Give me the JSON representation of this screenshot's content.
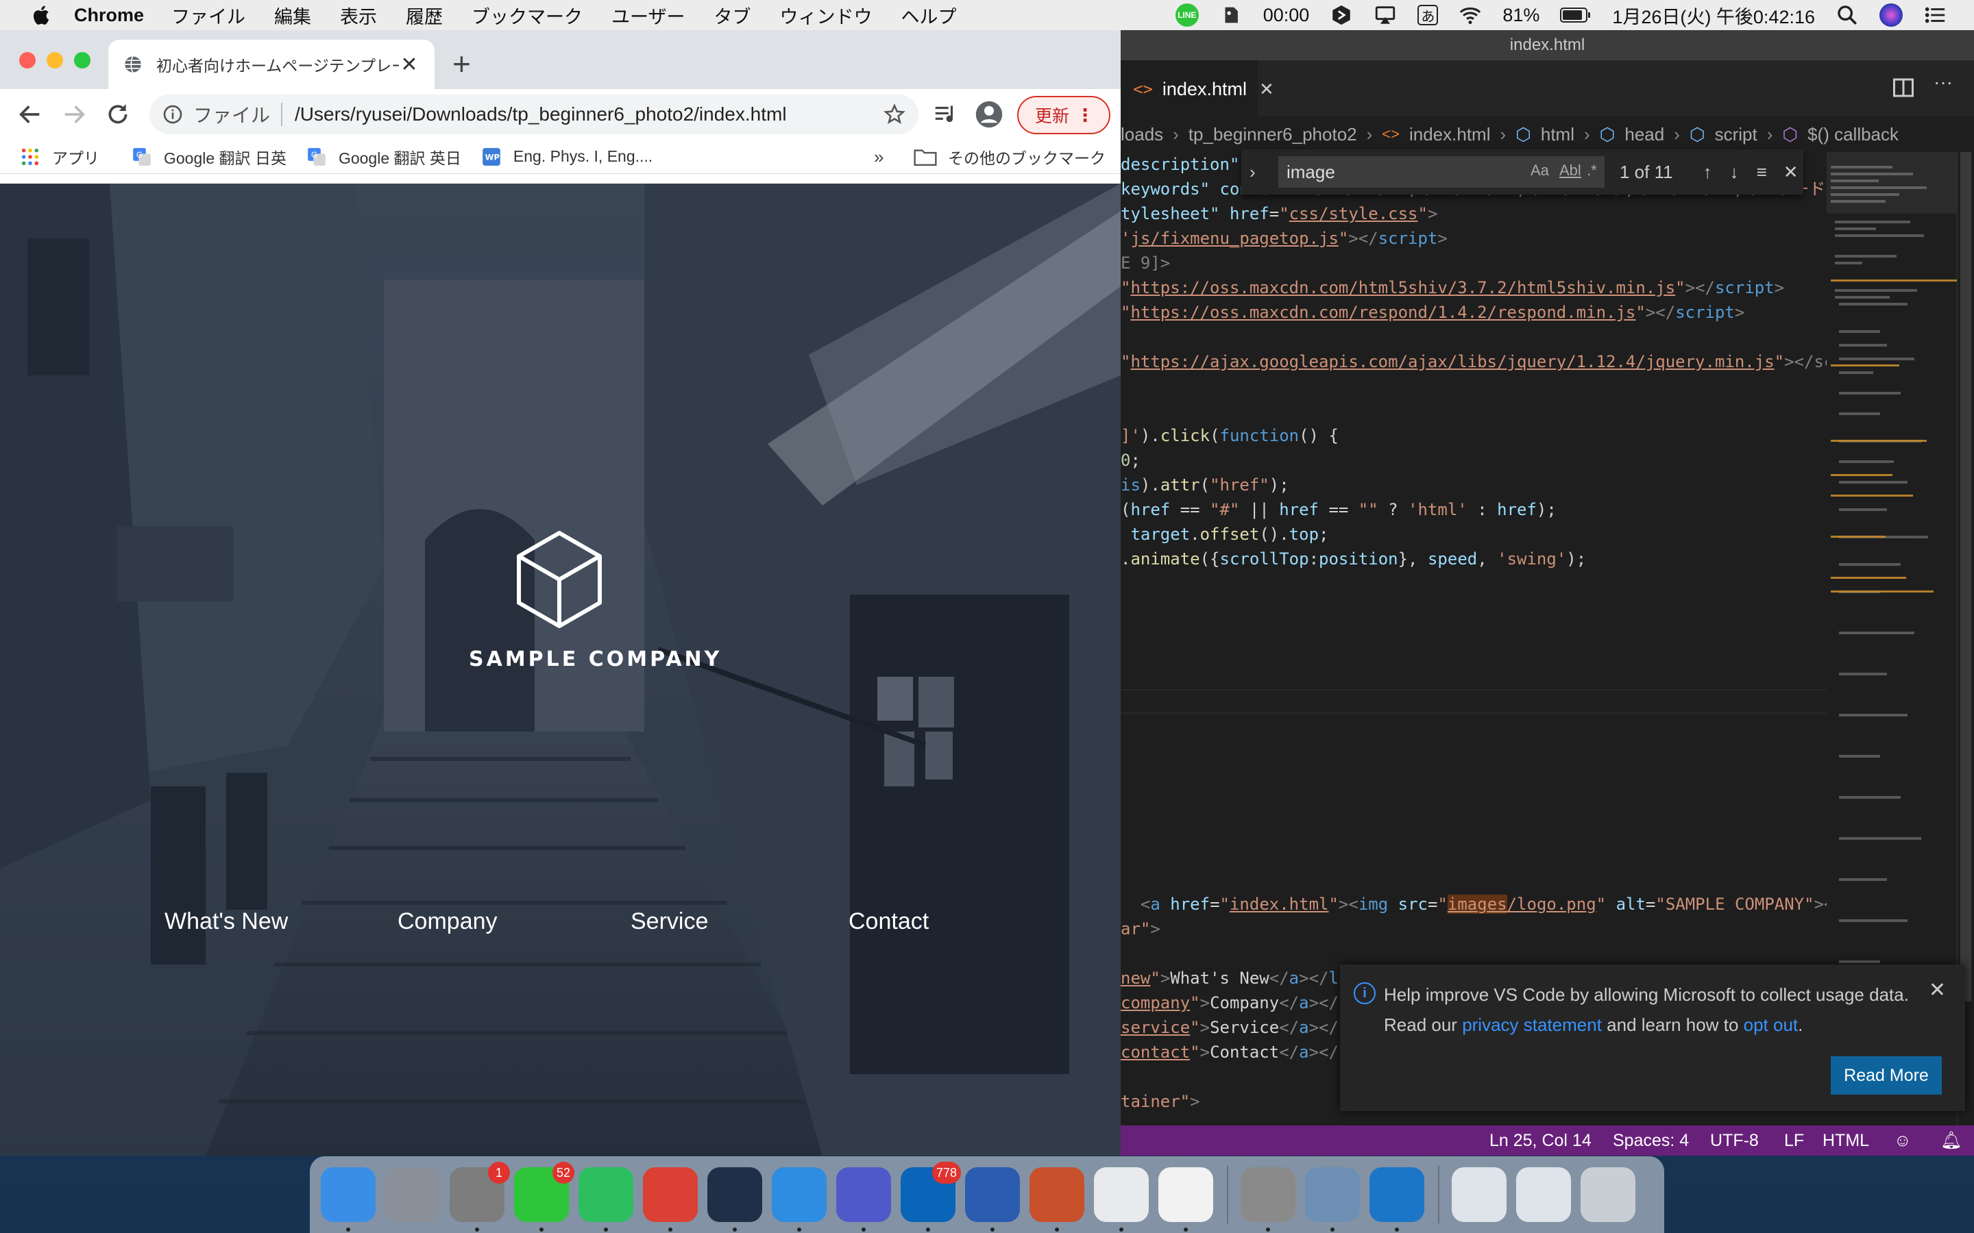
{
  "menubar": {
    "app_name": "Chrome",
    "menus": [
      "ファイル",
      "編集",
      "表示",
      "履歴",
      "ブックマーク",
      "ユーザー",
      "タブ",
      "ウィンドウ",
      "ヘルプ"
    ],
    "clock_status": "00:00",
    "input_method": "あ",
    "battery": "81%",
    "datetime": "1月26日(火) 午後0:42:16"
  },
  "chrome": {
    "tab_title": "初心者向けホームページテンプレー",
    "omnibox": {
      "scheme_label": "ファイル",
      "url": "/Users/ryusei/Downloads/tp_beginner6_photo2/index.html"
    },
    "update_label": "更新",
    "bookmarks": [
      {
        "label": "アプリ",
        "icon": "apps-grid-icon"
      },
      {
        "label": "Google 翻訳 日英",
        "icon": "google-translate-icon"
      },
      {
        "label": "Google 翻訳 英日",
        "icon": "google-translate-icon"
      },
      {
        "label": "Eng. Phys. I, Eng....",
        "icon": "wordpress-icon"
      }
    ],
    "bookmarks_more": "»",
    "other_bookmarks": "その他のブックマーク"
  },
  "page": {
    "company": "SAMPLE COMPANY",
    "nav": [
      "What's New",
      "Company",
      "Service",
      "Contact"
    ]
  },
  "vscode": {
    "window_title": "index.html",
    "tab_label": "index.html",
    "breadcrumbs": [
      "loads",
      "tp_beginner6_photo2",
      "index.html",
      "html",
      "head",
      "script",
      "$() callback"
    ],
    "find": {
      "query": "image",
      "options": [
        "Aa",
        "Abl",
        ".*"
      ],
      "count": "1 of 11"
    },
    "notification": {
      "text_before": "Help improve VS Code by allowing Microsoft to collect usage data. Read our ",
      "link1": "privacy statement",
      "text_middle": " and learn how to ",
      "link2": "opt out",
      "text_after": ".",
      "button": "Read More"
    },
    "status": {
      "position": "Ln 25, Col 14",
      "spaces": "Spaces: 4",
      "encoding": "UTF-8",
      "eol": "LF",
      "language": "HTML"
    }
  },
  "dock": {
    "apps": [
      {
        "name": "Finder",
        "color": "#3a8ee6",
        "badge": ""
      },
      {
        "name": "Launchpad",
        "color": "#8a8f99",
        "badge": ""
      },
      {
        "name": "System Preferences",
        "color": "#7d7d7d",
        "badge": "1"
      },
      {
        "name": "LINE",
        "color": "#2fc53a",
        "badge": "52"
      },
      {
        "name": "Evernote",
        "color": "#2dbe60",
        "badge": ""
      },
      {
        "name": "Todoist",
        "color": "#db4035",
        "badge": ""
      },
      {
        "name": "Affinity",
        "color": "#1f2f47",
        "badge": ""
      },
      {
        "name": "Safari",
        "color": "#2e8de0",
        "badge": ""
      },
      {
        "name": "Teams",
        "color": "#5059c9",
        "badge": ""
      },
      {
        "name": "Outlook",
        "color": "#0a64b8",
        "badge": "778"
      },
      {
        "name": "Word",
        "color": "#2b5cb0",
        "badge": ""
      },
      {
        "name": "MATLAB",
        "color": "#c8512c",
        "badge": ""
      },
      {
        "name": "Chrome",
        "color": "#e8eaed",
        "badge": ""
      },
      {
        "name": "TextEdit",
        "color": "#f2f2f2",
        "badge": ""
      },
      {
        "name": "Automator",
        "color": "#8a8a8a",
        "badge": ""
      },
      {
        "name": "Preview",
        "color": "#6d8fb3",
        "badge": ""
      },
      {
        "name": "VS Code",
        "color": "#1c76c8",
        "badge": ""
      },
      {
        "name": "Screenshot 1",
        "color": "#dfe4ea",
        "badge": ""
      },
      {
        "name": "Screenshot 2",
        "color": "#dfe4ea",
        "badge": ""
      },
      {
        "name": "Trash",
        "color": "#c9ced4",
        "badge": ""
      }
    ]
  }
}
